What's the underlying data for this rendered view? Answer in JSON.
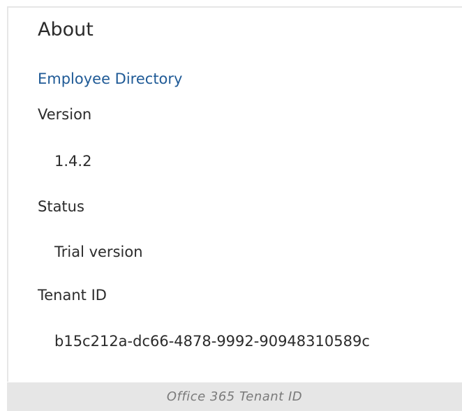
{
  "about": {
    "heading": "About",
    "app_name": "Employee Directory",
    "fields": [
      {
        "label": "Version",
        "value": "1.4.2"
      },
      {
        "label": "Status",
        "value": "Trial version"
      },
      {
        "label": "Tenant ID",
        "value": "b15c212a-dc66-4878-9992-90948310589c"
      }
    ]
  },
  "caption": "Office 365 Tenant ID",
  "colors": {
    "link": "#1f5a96",
    "text": "#2b2b2b",
    "border": "#e6e6e6",
    "caption_bg": "#e6e6e6",
    "caption_text": "#7a7a7a"
  }
}
